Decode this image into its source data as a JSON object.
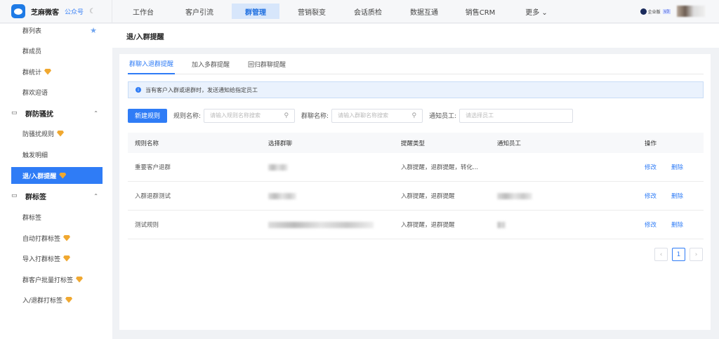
{
  "brand": {
    "name": "芝麻微客",
    "gzh": "公众号",
    "edition": "企业版",
    "version": "v3"
  },
  "nav": [
    "工作台",
    "客户引流",
    "群管理",
    "营销裂变",
    "会话质检",
    "数据互通",
    "销售CRM",
    "更多 ⌄"
  ],
  "nav_active": 2,
  "sidebar": {
    "items": [
      {
        "label": "群列表",
        "star": true
      },
      {
        "label": "群成员"
      },
      {
        "label": "群统计",
        "gem": true
      },
      {
        "label": "群欢迎语"
      },
      {
        "label": "群防骚扰",
        "group": true
      },
      {
        "label": "防骚扰规则",
        "gem": true
      },
      {
        "label": "触发明细"
      },
      {
        "label": "退/入群提醒",
        "gem": true,
        "active": true
      },
      {
        "label": "群标签",
        "group": true
      },
      {
        "label": "群标签"
      },
      {
        "label": "自动打群标签",
        "gem": true
      },
      {
        "label": "导入打群标签",
        "gem": true
      },
      {
        "label": "群客户批量打标签",
        "gem": true
      },
      {
        "label": "入/退群打标签",
        "gem": true
      }
    ]
  },
  "page_title": "退/入群提醒",
  "tabs": [
    "群聊入退群提醒",
    "加入多群提醒",
    "回归群聊提醒"
  ],
  "alert": "当有客户入群或退群时，发送通知给指定员工",
  "toolbar": {
    "new_rule": "新建规则",
    "rule_name_label": "规则名称:",
    "rule_name_placeholder": "请输入规则名称搜索",
    "group_name_label": "群聊名称:",
    "group_name_placeholder": "请输入群聊名称搜索",
    "staff_label": "通知员工:",
    "staff_placeholder": "请选择员工"
  },
  "table": {
    "headers": [
      "规则名称",
      "选择群聊",
      "提醒类型",
      "通知员工",
      "操作"
    ],
    "rows": [
      {
        "name": "重要客户退群",
        "type": "入群提醒，退群提醒，转化...",
        "edit": "修改",
        "delete": "删除"
      },
      {
        "name": "入群退群测试",
        "type": "入群提醒，退群提醒",
        "edit": "修改",
        "delete": "删除"
      },
      {
        "name": "测试规则",
        "type": "入群提醒，退群提醒",
        "edit": "修改",
        "delete": "删除"
      }
    ]
  },
  "pagination": {
    "prev": "‹",
    "current": "1",
    "next": "›"
  },
  "colors": {
    "accent": "#2f7cf6",
    "gem": "#f0a830"
  }
}
